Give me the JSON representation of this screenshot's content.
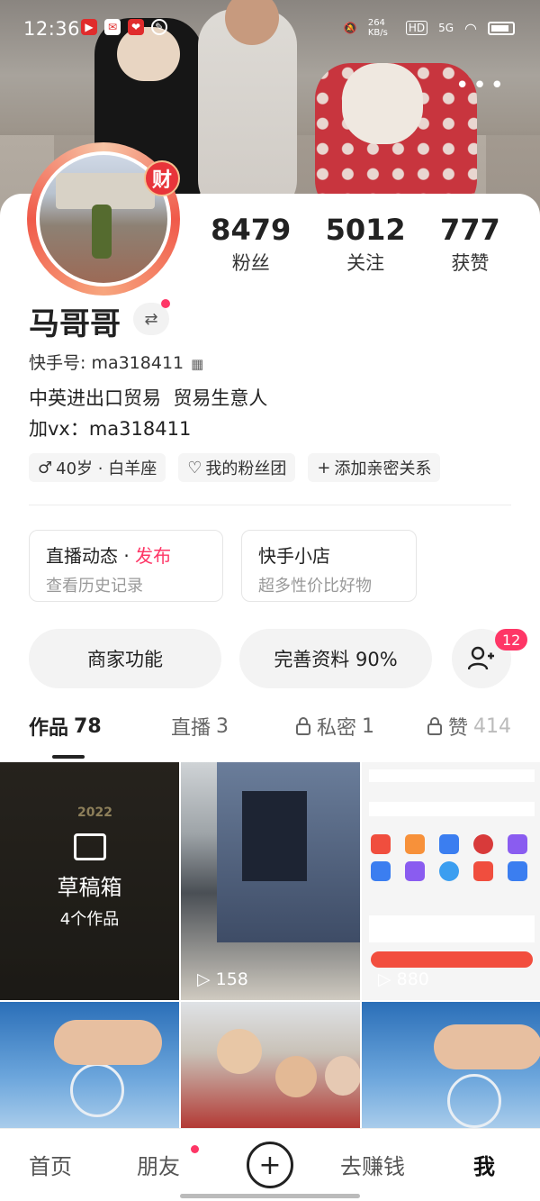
{
  "status_bar": {
    "time": "12:36",
    "network_speed": "264 KB/s",
    "hd_label": "HD",
    "signal_label": "5G"
  },
  "profile": {
    "name": "马哥哥",
    "kuaishou_id_label": "快手号: ma318411",
    "bio_line1": "中英进出口贸易  贸易生意人",
    "bio_line2": "加vx：ma318411",
    "fortune_badge": "财",
    "stats": [
      {
        "value": "8479",
        "label": "粉丝"
      },
      {
        "value": "5012",
        "label": "关注"
      },
      {
        "value": "777",
        "label": "获赞"
      }
    ],
    "tags": [
      {
        "icon": "male-icon",
        "label": "40岁 · 白羊座"
      },
      {
        "icon": "heart-icon",
        "label": "我的粉丝团"
      },
      {
        "icon": "plus-icon",
        "label": "添加亲密关系"
      }
    ]
  },
  "feature_boxes": [
    {
      "title": "直播动态",
      "separator": " · ",
      "highlight": "发布",
      "subtitle": "查看历史记录"
    },
    {
      "title": "快手小店",
      "subtitle": "超多性价比好物"
    }
  ],
  "action_buttons": {
    "merchant": "商家功能",
    "complete_profile": "完善资料 90%",
    "friend_badge": "12"
  },
  "tabs": [
    {
      "label": "作品",
      "count": "78",
      "locked": false
    },
    {
      "label": "直播",
      "count": "3",
      "locked": false
    },
    {
      "label": "私密",
      "count": "1",
      "locked": true
    },
    {
      "label": "赞",
      "count": "414",
      "locked": true
    }
  ],
  "grid": {
    "drafts_title": "草稿箱",
    "drafts_count": "4个作品",
    "drafts_year": "2022",
    "items": [
      {
        "plays": "158"
      },
      {
        "plays": "880"
      }
    ]
  },
  "bottom_nav": [
    {
      "label": "首页"
    },
    {
      "label": "朋友"
    },
    {
      "label": "去赚钱"
    },
    {
      "label": "我"
    }
  ],
  "colors": {
    "accent": "#fe3666",
    "text_primary": "#222222",
    "text_secondary": "#999999"
  }
}
